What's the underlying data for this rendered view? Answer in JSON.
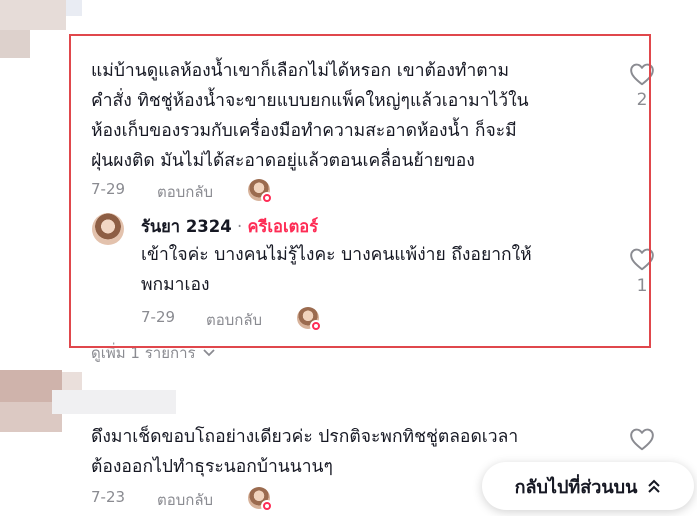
{
  "comments": [
    {
      "text_lines": [
        "แม่บ้านดูแลห้องน้ำเขาก็เลือกไม่ได้หรอก เขาต้องทำตาม",
        "คำสั่ง ทิชชู่ห้องน้ำจะขายแบบยกแพ็คใหญ่ๆแล้วเอามาไว้ใน",
        "ห้องเก็บของรวมกับเครื่องมือทำความสะอาดห้องน้ำ ก็จะมี",
        "ฝุ่นผงติด มันไม่ได้สะอาดอยู่แล้วตอนเคลื่อนย้ายของ"
      ],
      "date": "7-29",
      "reply_label": "ตอบกลับ",
      "like_count": "2",
      "reply": {
        "username": "รันยา 2324",
        "separator": "·",
        "creator_badge": "ครีเอเตอร์",
        "text_lines": [
          "เข้าใจค่ะ บางคนไม่รู้ไงคะ บางคนแพ้ง่าย ถึงอยากให้",
          "พกมาเอง"
        ],
        "date": "7-29",
        "reply_label": "ตอบกลับ",
        "like_count": "1"
      },
      "view_more": "ดูเพิ่ม 1 รายการ"
    },
    {
      "text_lines": [
        "ดึงมาเช็ดขอบโถอย่างเดียวค่ะ ปรกติจะพกทิชชู่ตลอดเวลา",
        "ต้องออกไปทำธุระนอกบ้านนานๆ"
      ],
      "date": "7-23",
      "reply_label": "ตอบกลับ"
    }
  ],
  "back_to_top": {
    "label": "กลับไปที่ส่วนบน",
    "icon": "double-chevron-up-icon"
  },
  "colors": {
    "highlight": "#e0474c",
    "creator": "#fe2c55",
    "meta": "#8a8b91",
    "text": "#161823"
  }
}
